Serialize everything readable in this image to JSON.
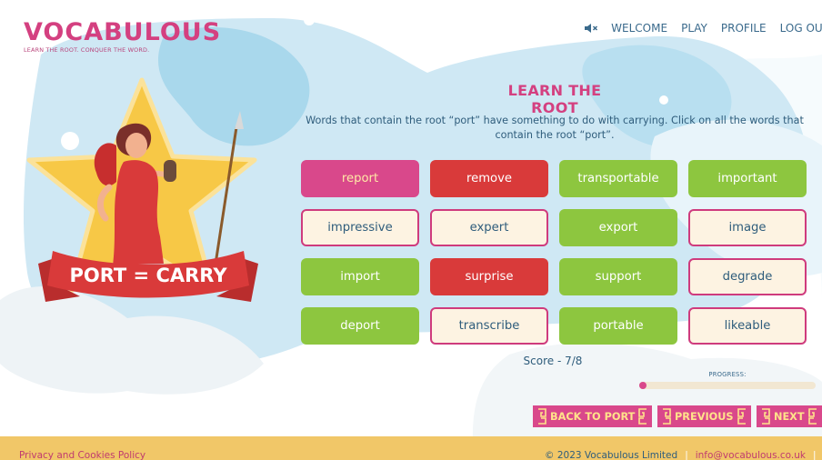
{
  "header": {
    "logo_title": "VOCABULOUS",
    "logo_tagline": "LEARN THE ROOT. CONQUER THE WORD.",
    "sound_icon": "speaker-muted-icon",
    "nav": [
      "WELCOME",
      "PLAY",
      "PROFILE",
      "LOG OUT"
    ]
  },
  "hero": {
    "banner_text": "PORT = CARRY"
  },
  "content": {
    "heading": "LEARN THE ROOT",
    "instructions": "Words that contain the root “port” have something to do with carrying. Click on all the words that contain the root “port”.",
    "words": [
      {
        "text": "report",
        "state": "selected"
      },
      {
        "text": "remove",
        "state": "wrong"
      },
      {
        "text": "transportable",
        "state": "correct"
      },
      {
        "text": "important",
        "state": "correct"
      },
      {
        "text": "impressive",
        "state": "unselected"
      },
      {
        "text": "expert",
        "state": "unselected"
      },
      {
        "text": "export",
        "state": "correct"
      },
      {
        "text": "image",
        "state": "unselected"
      },
      {
        "text": "import",
        "state": "correct"
      },
      {
        "text": "surprise",
        "state": "wrong"
      },
      {
        "text": "support",
        "state": "correct"
      },
      {
        "text": "degrade",
        "state": "unselected"
      },
      {
        "text": "deport",
        "state": "correct"
      },
      {
        "text": "transcribe",
        "state": "unselected"
      },
      {
        "text": "portable",
        "state": "correct"
      },
      {
        "text": "likeable",
        "state": "unselected"
      }
    ],
    "score": "Score - 7/8",
    "progress_label": "PROGRESS:",
    "progress_fraction": 0.04
  },
  "buttons": {
    "back": "BACK TO PORT",
    "previous": "PREVIOUS",
    "next": "NEXT"
  },
  "footer": {
    "policy": "Privacy and Cookies Policy",
    "copyright": "© 2023 Vocabulous Limited",
    "email": "info@vocabulous.co.uk",
    "twitter_icon": "twitter-icon"
  },
  "colors": {
    "brand_pink": "#d9488b",
    "correct_green": "#8dc63f",
    "wrong_red": "#d93a3a",
    "sky_blue": "#cfe8f4",
    "footer_gold": "#f1c768"
  }
}
